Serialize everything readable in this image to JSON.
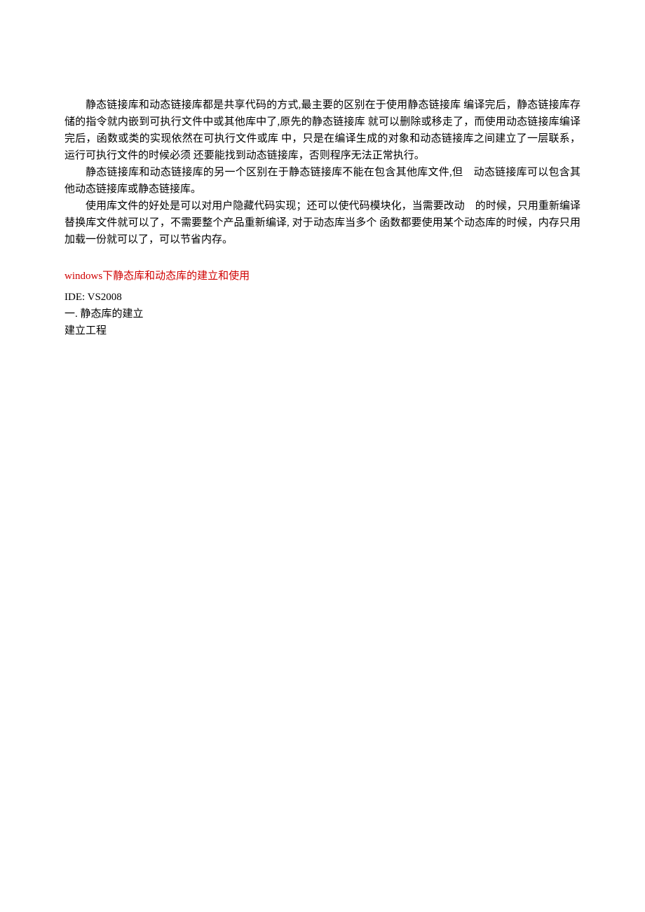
{
  "paragraphs": {
    "p1": "静态链接库和动态链接库都是共享代码的方式,最主要的区别在于使用静态链接库 编译完后，静态链接库存储的指令就内嵌到可执行文件中或其他库中了,原先的静态链接库 就可以删除或移走了，而使用动态链接库编译完后，函数或类的实现依然在可执行文件或库 中，只是在编译生成的对象和动态链接库之间建立了一层联系，运行可执行文件的时候必须 还要能找到动态链接库，否则程序无法正常执行。",
    "p2": "静态链接库和动态链接库的另一个区别在于静态链接库不能在包含其他库文件,但　动态链接库可以包含其他动态链接库或静态链接库。",
    "p3": "使用库文件的好处是可以对用户隐藏代码实现；还可以使代码模块化，当需要改动　的时候，只用重新编译替换库文件就可以了，不需要整个产品重新编译, 对于动态库当多个 函数都要使用某个动态库的时候，内存只用加载一份就可以了，可以节省内存。"
  },
  "heading": "windows下静态库和动态库的建立和使用",
  "lines": {
    "l1": "IDE: VS2008",
    "l2": "一. 静态库的建立",
    "l3": "建立工程"
  }
}
